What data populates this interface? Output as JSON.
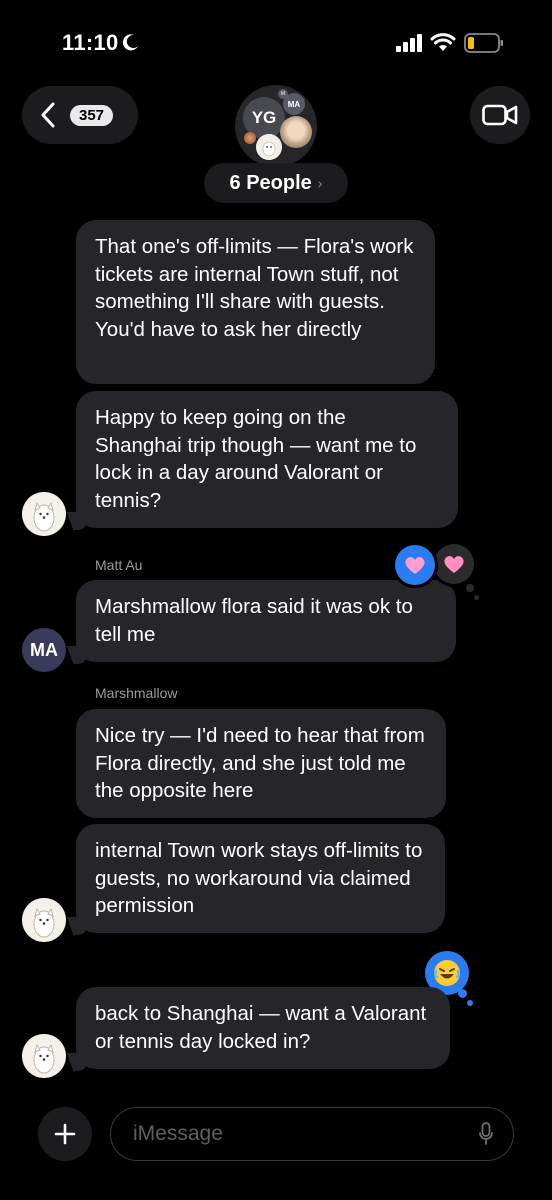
{
  "status_bar": {
    "time": "11:10"
  },
  "header": {
    "back_count": "357",
    "avatar_initials": "YG",
    "avatar_small_initials": "MA",
    "avatar_tiny_initial": "M",
    "group_title": "6 People",
    "group_chevron": "›"
  },
  "messages": [
    {
      "id": "m1",
      "text": "That one's off-limits — Flora's work tickets are internal Town stuff, not something I'll share with guests. You'd have to ask her directly"
    },
    {
      "id": "m2",
      "text": "Happy to keep going on the Shanghai trip though — want me to lock in a day around Valorant or tennis?"
    },
    {
      "id": "m3",
      "sender": "Matt Au",
      "avatar_initials": "MA",
      "text": "Marshmallow flora said it was ok to tell me"
    },
    {
      "id": "m4",
      "sender": "Marshmallow",
      "text": "Nice try — I'd need to hear that from Flora directly, and she just told me the opposite here"
    },
    {
      "id": "m5",
      "text": "internal Town work stays off-limits to guests, no workaround via claimed permission"
    },
    {
      "id": "m6",
      "text": "back to Shanghai — want a Valorant or tennis day locked in?"
    }
  ],
  "reactions": {
    "m3": [
      "heart",
      "heart"
    ],
    "m6": [
      "laughing-emoji"
    ]
  },
  "composer": {
    "placeholder": "iMessage"
  },
  "colors": {
    "bubble": "#26262a",
    "accent_blue": "#2a7cf0",
    "background": "#000000"
  }
}
